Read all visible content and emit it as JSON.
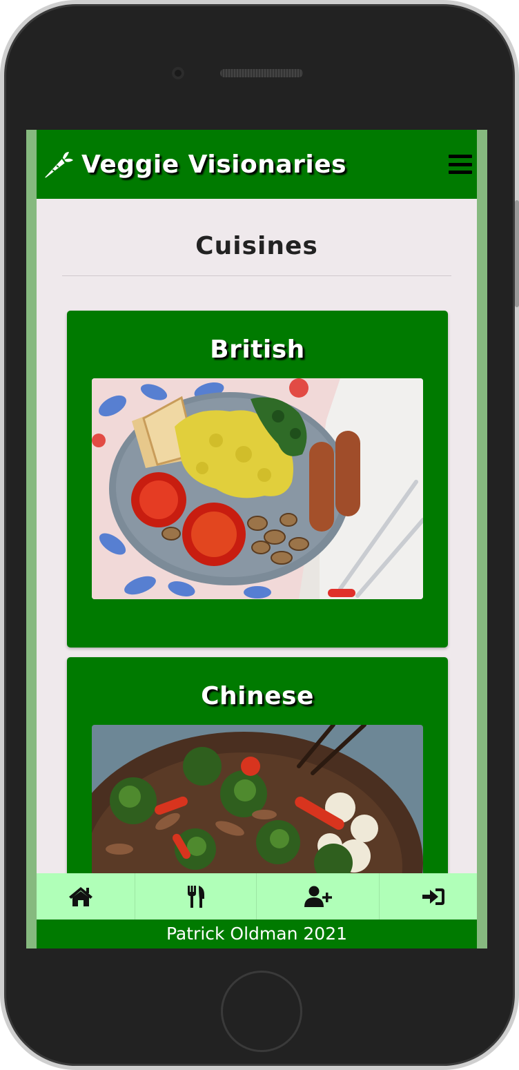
{
  "header": {
    "brand": "Veggie Visionaries",
    "logo_icon": "carrot-icon",
    "menu_icon": "hamburger-menu-icon"
  },
  "main": {
    "title": "Cuisines",
    "cards": [
      {
        "title": "British",
        "image": "british-breakfast-image"
      },
      {
        "title": "Chinese",
        "image": "chinese-stir-fry-image"
      }
    ]
  },
  "bottom_nav": {
    "items": [
      {
        "icon": "home-icon"
      },
      {
        "icon": "utensils-icon"
      },
      {
        "icon": "user-plus-icon"
      },
      {
        "icon": "sign-in-icon"
      }
    ]
  },
  "footer": {
    "text": "Patrick Oldman 2021"
  },
  "colors": {
    "primary": "#007a00",
    "nav_bg": "#b0ffb8",
    "page_bg": "#efe9ec",
    "side_border": "#86b97f"
  }
}
